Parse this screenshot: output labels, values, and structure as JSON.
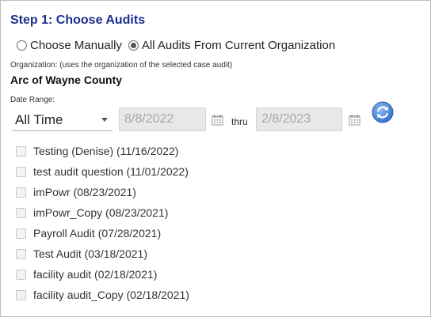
{
  "title": "Step 1: Choose Audits",
  "mode": {
    "options": [
      {
        "label": "Choose Manually",
        "checked": false
      },
      {
        "label": "All Audits From Current Organization",
        "checked": true
      }
    ]
  },
  "organization": {
    "note": "Organization: (uses the organization of the selected case audit)",
    "name": "Arc of Wayne County"
  },
  "date_range": {
    "label": "Date Range:",
    "selected": "All Time",
    "from_placeholder": "8/8/2022",
    "thru_label": "thru",
    "to_placeholder": "2/8/2023"
  },
  "audits": [
    {
      "label": "Testing (Denise) (11/16/2022)",
      "checked": false
    },
    {
      "label": "test audit question (11/01/2022)",
      "checked": false
    },
    {
      "label": "imPowr (08/23/2021)",
      "checked": false
    },
    {
      "label": "imPowr_Copy (08/23/2021)",
      "checked": false
    },
    {
      "label": "Payroll Audit (07/28/2021)",
      "checked": false
    },
    {
      "label": "Test Audit (03/18/2021)",
      "checked": false
    },
    {
      "label": "facility audit (02/18/2021)",
      "checked": false
    },
    {
      "label": "facility audit_Copy (02/18/2021)",
      "checked": false
    }
  ],
  "icons": {
    "calendar": "calendar-icon",
    "refresh": "refresh-icon"
  },
  "colors": {
    "title": "#1c2e8a",
    "refresh": "#3f7fd8"
  }
}
